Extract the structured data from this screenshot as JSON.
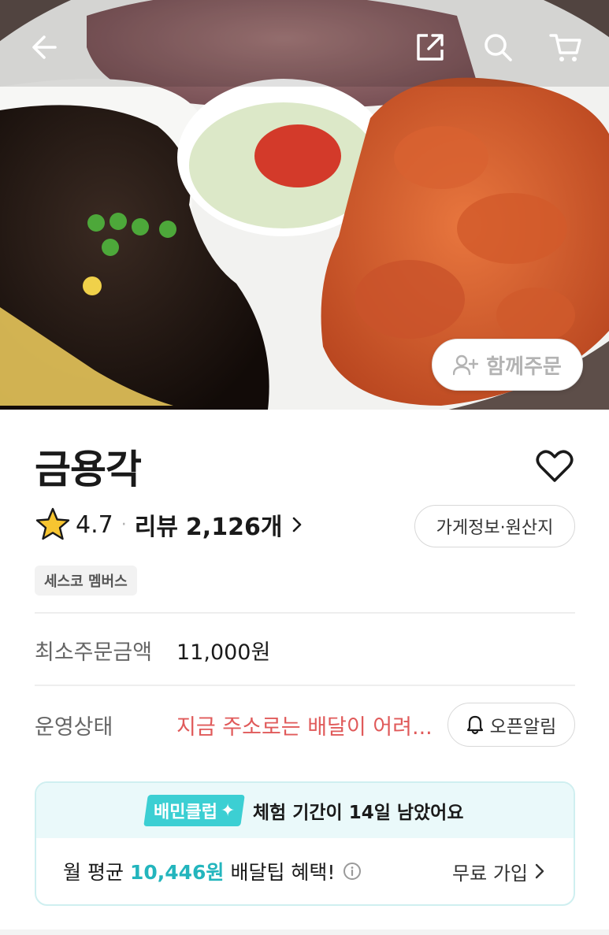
{
  "header": {
    "back_icon": "arrow-left-icon",
    "share_icon": "share-icon",
    "search_icon": "search-icon",
    "cart_icon": "cart-icon"
  },
  "hero": {
    "together_order_label": "함께주문",
    "together_icon": "add-person-icon"
  },
  "store": {
    "name": "금용각",
    "rating": "4.7",
    "separator": "·",
    "review_label": "리뷰",
    "review_count": "2,126개",
    "info_button": "가게정보·원산지",
    "badge": "세스코 멤버스"
  },
  "details": {
    "min_order_label": "최소주문금액",
    "min_order_value": "11,000원",
    "status_label": "운영상태",
    "status_value": "지금 주소로는 배달이 어려...",
    "open_alert_label": "오픈알림"
  },
  "club": {
    "chip_label": "배민클럽",
    "trial_message": "체험 기간이 14일 남았어요",
    "benefit_prefix": "월 평균",
    "benefit_amount": "10,446원",
    "benefit_suffix": "배달팁 혜택!",
    "join_label": "무료 가입"
  },
  "colors": {
    "accent_mint": "#3ccfd3",
    "benefit_teal": "#23b5bd",
    "status_red": "#e05a5a",
    "star_yellow": "#f7c531"
  }
}
